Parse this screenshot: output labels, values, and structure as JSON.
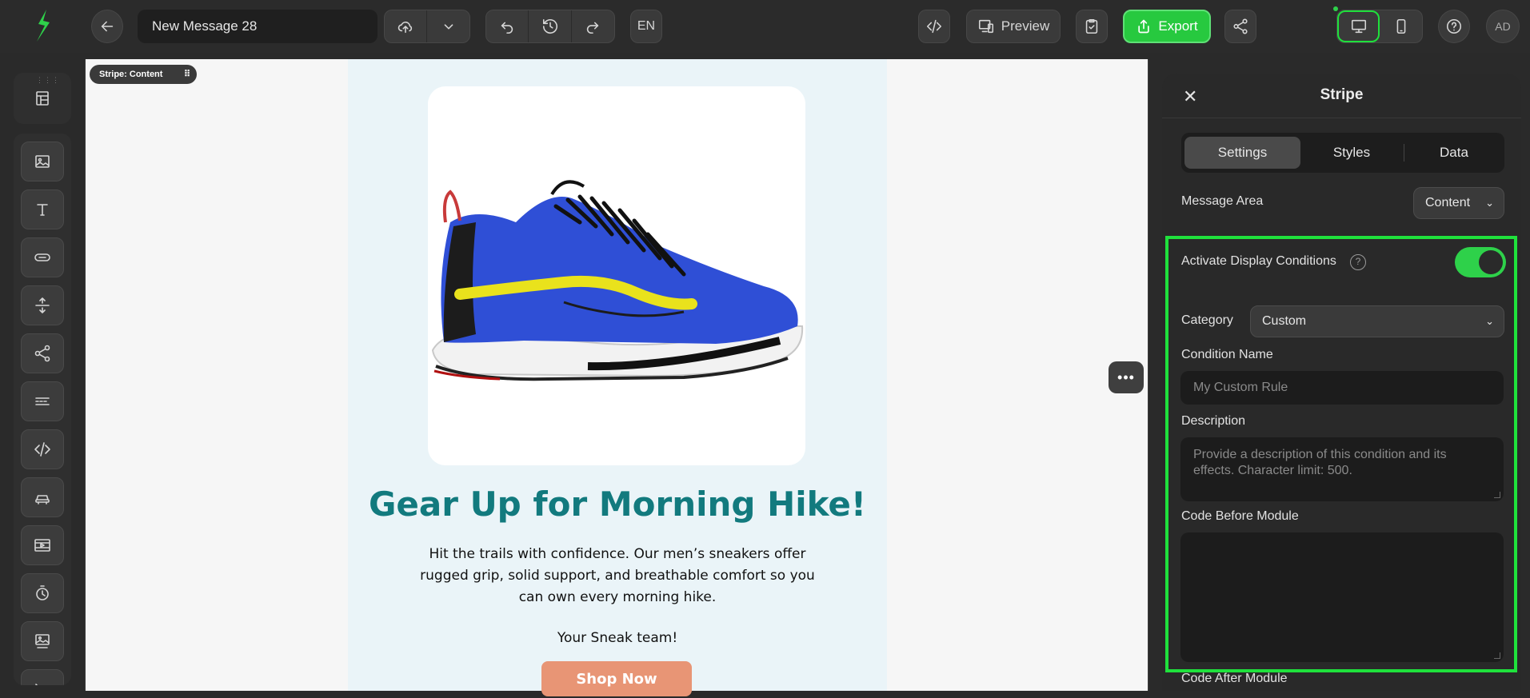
{
  "topbar": {
    "message_title": "New Message 28",
    "language": "EN",
    "preview_label": "Preview",
    "export_label": "Export",
    "user_initials": "AD"
  },
  "canvas": {
    "stripe_tag": "Stripe: Content",
    "headline": "Gear Up for Morning Hike!",
    "body": "Hit the trails with confidence. Our men’s sneakers offer rugged grip, solid support, and breathable comfort so you can own every morning hike.",
    "signoff": "Your Sneak team!",
    "cta_label": "Shop Now"
  },
  "panel": {
    "title": "Stripe",
    "tabs": [
      {
        "label": "Settings",
        "active": true
      },
      {
        "label": "Styles",
        "active": false
      },
      {
        "label": "Data",
        "active": false
      }
    ],
    "message_area_label": "Message Area",
    "message_area_value": "Content",
    "activate_label": "Activate Display Conditions",
    "activate_on": true,
    "category_label": "Category",
    "category_value": "Custom",
    "condition_name_label": "Condition Name",
    "condition_name_placeholder": "My Custom Rule",
    "description_label": "Description",
    "description_placeholder": "Provide a description of this condition and its effects. Character limit: 500.",
    "code_before_label": "Code Before Module",
    "code_after_label": "Code After Module"
  },
  "colors": {
    "accent_green": "#27c93f",
    "headline_teal": "#127a7e",
    "cta_orange": "#e89575",
    "highlight_border": "#1fe13c"
  },
  "icons": [
    "logo-icon",
    "back-arrow-icon",
    "cloud-upload-icon",
    "chevron-down-icon",
    "undo-icon",
    "history-icon",
    "redo-icon",
    "code-icon",
    "preview-devices-icon",
    "clipboard-check-icon",
    "export-icon",
    "share-icon",
    "desktop-icon",
    "mobile-icon",
    "help-icon"
  ]
}
